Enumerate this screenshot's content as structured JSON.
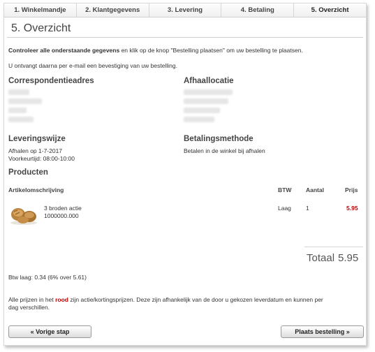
{
  "steps": [
    {
      "label": "1. Winkelmandje"
    },
    {
      "label": "2. Klantgegevens"
    },
    {
      "label": "3. Levering"
    },
    {
      "label": "4. Betaling"
    },
    {
      "label": "5. Overzicht"
    }
  ],
  "page_title": "5. Overzicht",
  "intro": {
    "bold": "Controleer alle onderstaande gegevens",
    "rest": " en klik op de knop \"Bestelling plaatsen\" om uw bestelling te plaatsen.",
    "confirmation": "U ontvangt daarna per e-mail een bevestiging van uw bestelling."
  },
  "correspondence": {
    "heading": "Correspondentieadres"
  },
  "pickup": {
    "heading": "Afhaallocatie"
  },
  "delivery": {
    "heading": "Leveringswijze",
    "line1": "Afhalen op 1-7-2017",
    "line2": "Voorkeurtijd: 08:00-10:00"
  },
  "payment": {
    "heading": "Betalingsmethode",
    "line1": "Betalen in de winkel bij afhalen"
  },
  "products": {
    "heading": "Producten",
    "columns": {
      "description": "Artikelomschrijving",
      "vat": "BTW",
      "quantity": "Aantal",
      "price": "Prijs"
    },
    "rows": [
      {
        "name": "3 broden actie",
        "code": "1000000.000",
        "vat": "Laag",
        "quantity": "1",
        "price": "5.95"
      }
    ]
  },
  "total": {
    "label": "Totaal",
    "value": "5.95"
  },
  "vat_note": "Btw laag: 0.34 (6% over 5.61)",
  "price_note": {
    "part1": "Alle prijzen in het ",
    "red_word": "rood",
    "part2": " zijn actie/kortingsprijzen. Deze zijn afhankelijk van de door u gekozen leverdatum en kunnen per",
    "line2": "dag verschillen."
  },
  "buttons": {
    "back": "« Vorige stap",
    "submit": "Plaats bestelling »"
  },
  "colors": {
    "accent_red": "#c00000"
  }
}
